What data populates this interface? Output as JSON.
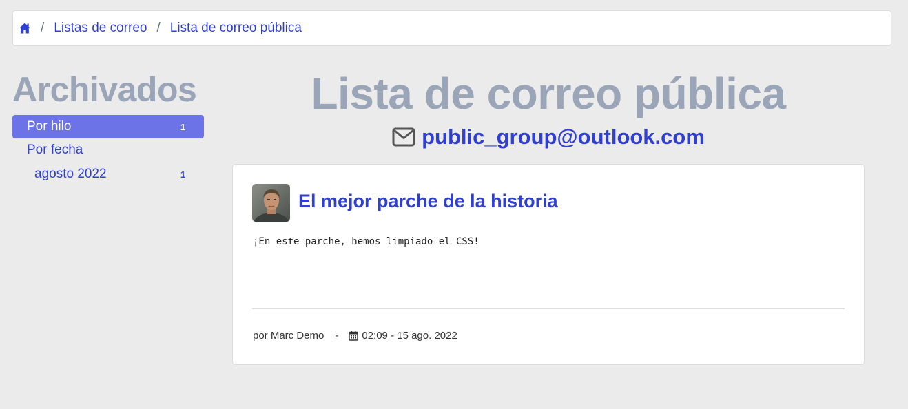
{
  "breadcrumb": {
    "home_icon": "home-icon",
    "separator": "/",
    "items": [
      {
        "label": "Listas de correo"
      },
      {
        "label": "Lista de correo pública"
      }
    ]
  },
  "sidebar": {
    "title": "Archivados",
    "items": [
      {
        "label": "Por hilo",
        "count": "1",
        "active": true
      },
      {
        "label": "Por fecha",
        "count": ""
      },
      {
        "label": "agosto 2022",
        "count": "1"
      }
    ]
  },
  "main": {
    "title": "Lista de correo pública",
    "email_icon": "envelope-icon",
    "email": "public_group@outlook.com"
  },
  "message": {
    "subject": "El mejor parche de la historia",
    "body": "¡En este parche, hemos limpiado el CSS!",
    "author": "por Marc Demo",
    "dash": "-",
    "date_icon": "calendar-icon",
    "date": "02:09 - 15 ago. 2022"
  },
  "colors": {
    "link": "#2f3fd0",
    "muted_heading": "#9aa5b8",
    "active_item_bg": "#6b73e6",
    "page_bg": "#ebebeb"
  }
}
